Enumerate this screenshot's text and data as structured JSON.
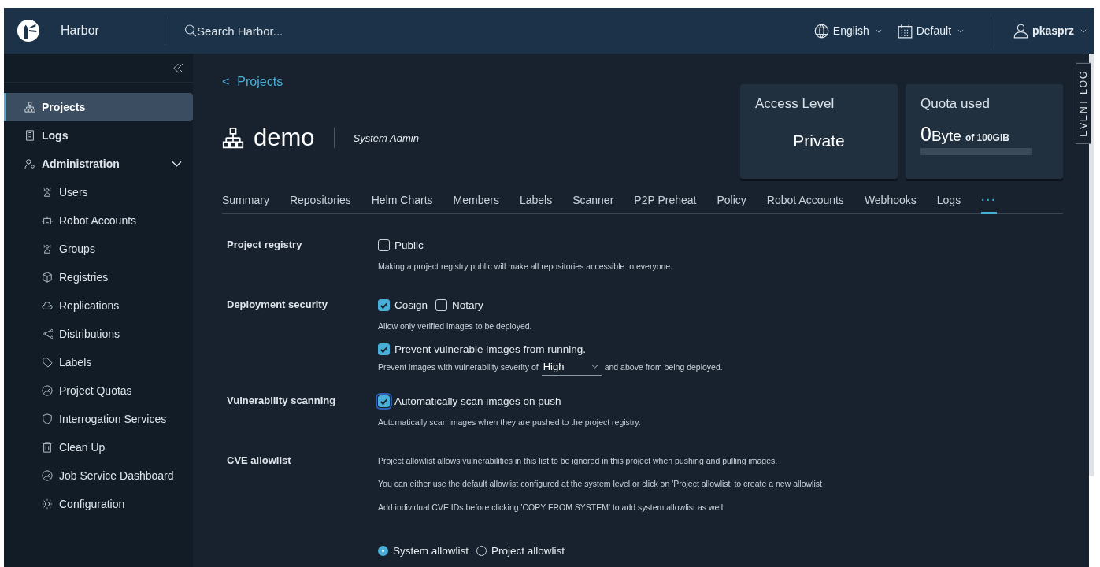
{
  "header": {
    "product": "Harbor",
    "search_placeholder": "Search Harbor...",
    "language": "English",
    "theme": "Default",
    "user": "pkasprz"
  },
  "sidebar": {
    "items": [
      {
        "label": "Projects",
        "selected": true
      },
      {
        "label": "Logs",
        "selected": false
      },
      {
        "label": "Administration",
        "selected": false,
        "expanded": true,
        "children": [
          {
            "label": "Users",
            "selected": false
          },
          {
            "label": "Robot Accounts",
            "selected": false
          },
          {
            "label": "Groups",
            "selected": false
          },
          {
            "label": "Registries",
            "selected": false
          },
          {
            "label": "Replications",
            "selected": false
          },
          {
            "label": "Distributions",
            "selected": false
          },
          {
            "label": "Labels",
            "selected": false
          },
          {
            "label": "Project Quotas",
            "selected": false
          },
          {
            "label": "Interrogation Services",
            "selected": false
          },
          {
            "label": "Clean Up",
            "selected": false
          },
          {
            "label": "Job Service Dashboard",
            "selected": false
          },
          {
            "label": "Configuration",
            "selected": false
          }
        ]
      }
    ]
  },
  "breadcrumb": {
    "arrow": "<",
    "label": "Projects"
  },
  "project": {
    "name": "demo",
    "role": "System Admin"
  },
  "cards": {
    "access": {
      "title": "Access Level",
      "value": "Private"
    },
    "quota": {
      "title": "Quota used",
      "amount": "0",
      "unit": "Byte",
      "of": "of 100GiB",
      "level": 0
    }
  },
  "tabs": [
    {
      "label": "Summary",
      "selected": false
    },
    {
      "label": "Repositories",
      "selected": false
    },
    {
      "label": "Helm Charts",
      "selected": false
    },
    {
      "label": "Members",
      "selected": false
    },
    {
      "label": "Labels",
      "selected": false
    },
    {
      "label": "Scanner",
      "selected": false
    },
    {
      "label": "P2P Preheat",
      "selected": false
    },
    {
      "label": "Policy",
      "selected": false
    },
    {
      "label": "Robot Accounts",
      "selected": false
    },
    {
      "label": "Webhooks",
      "selected": false
    },
    {
      "label": "Logs",
      "selected": false
    },
    {
      "label": "···",
      "selected": true
    }
  ],
  "settings": [
    {
      "label": "Project registry",
      "items": [
        {
          "kind": "checkboxes",
          "options": [
            {
              "label": "Public",
              "checked": false,
              "focused": false
            }
          ]
        },
        {
          "kind": "note",
          "text": "Making a project registry public will make all repositories accessible to everyone."
        }
      ]
    },
    {
      "label": "Deployment security",
      "items": [
        {
          "kind": "checkboxes",
          "options": [
            {
              "label": "Cosign",
              "checked": true,
              "focused": false
            },
            {
              "label": "Notary",
              "checked": false,
              "focused": false
            }
          ]
        },
        {
          "kind": "note",
          "text": "Allow only verified images to be deployed."
        },
        {
          "kind": "checkboxes",
          "options": [
            {
              "label": "Prevent vulnerable images from running.",
              "checked": true,
              "focused": false
            }
          ]
        },
        {
          "kind": "severity",
          "before": "Prevent images with vulnerability severity of",
          "value": "High",
          "after": "and above from being deployed."
        }
      ]
    },
    {
      "label": "Vulnerability scanning",
      "items": [
        {
          "kind": "checkboxes",
          "options": [
            {
              "label": "Automatically scan images on push",
              "checked": true,
              "focused": true
            }
          ]
        },
        {
          "kind": "note",
          "text": "Automatically scan images when they are pushed to the project registry."
        }
      ]
    },
    {
      "label": "CVE allowlist",
      "items": [
        {
          "kind": "note",
          "text": "Project allowlist allows vulnerabilities in this list to be ignored in this project when pushing and pulling images."
        },
        {
          "kind": "note",
          "text": "You can either use the default allowlist configured at the system level or click on 'Project allowlist' to create a new allowlist"
        },
        {
          "kind": "note",
          "text": "Add individual CVE IDs before clicking 'COPY FROM SYSTEM' to add system allowlist as well."
        },
        {
          "kind": "radios",
          "options": [
            {
              "label": "System allowlist",
              "selected": true
            },
            {
              "label": "Project allowlist",
              "selected": false
            }
          ]
        }
      ]
    }
  ],
  "event_log": "EVENT LOG"
}
